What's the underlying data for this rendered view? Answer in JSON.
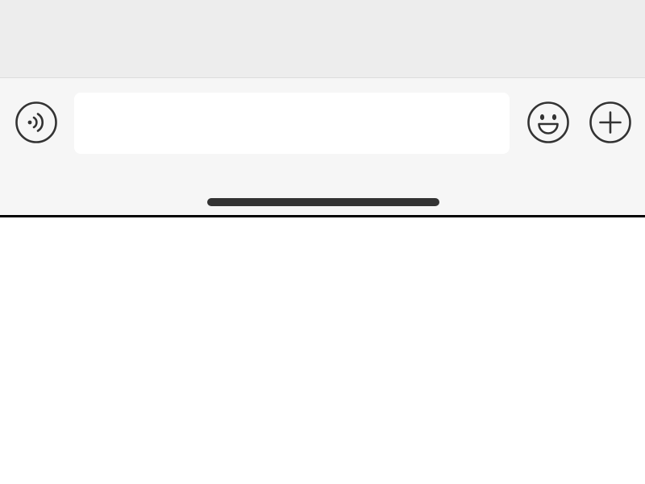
{
  "colors": {
    "chat_background": "#ededed",
    "input_bar_background": "#f6f6f6",
    "divider": "#dcdcdc",
    "input_background": "#ffffff",
    "icon_stroke": "#333333",
    "home_indicator": "#333333",
    "bottom_edge": "#000000",
    "page_background": "#ffffff"
  },
  "toolbar": {
    "voice_icon": "voice-icon",
    "emoji_icon": "emoji-icon",
    "add_icon": "plus-icon"
  },
  "message_input": {
    "value": "",
    "placeholder": ""
  }
}
